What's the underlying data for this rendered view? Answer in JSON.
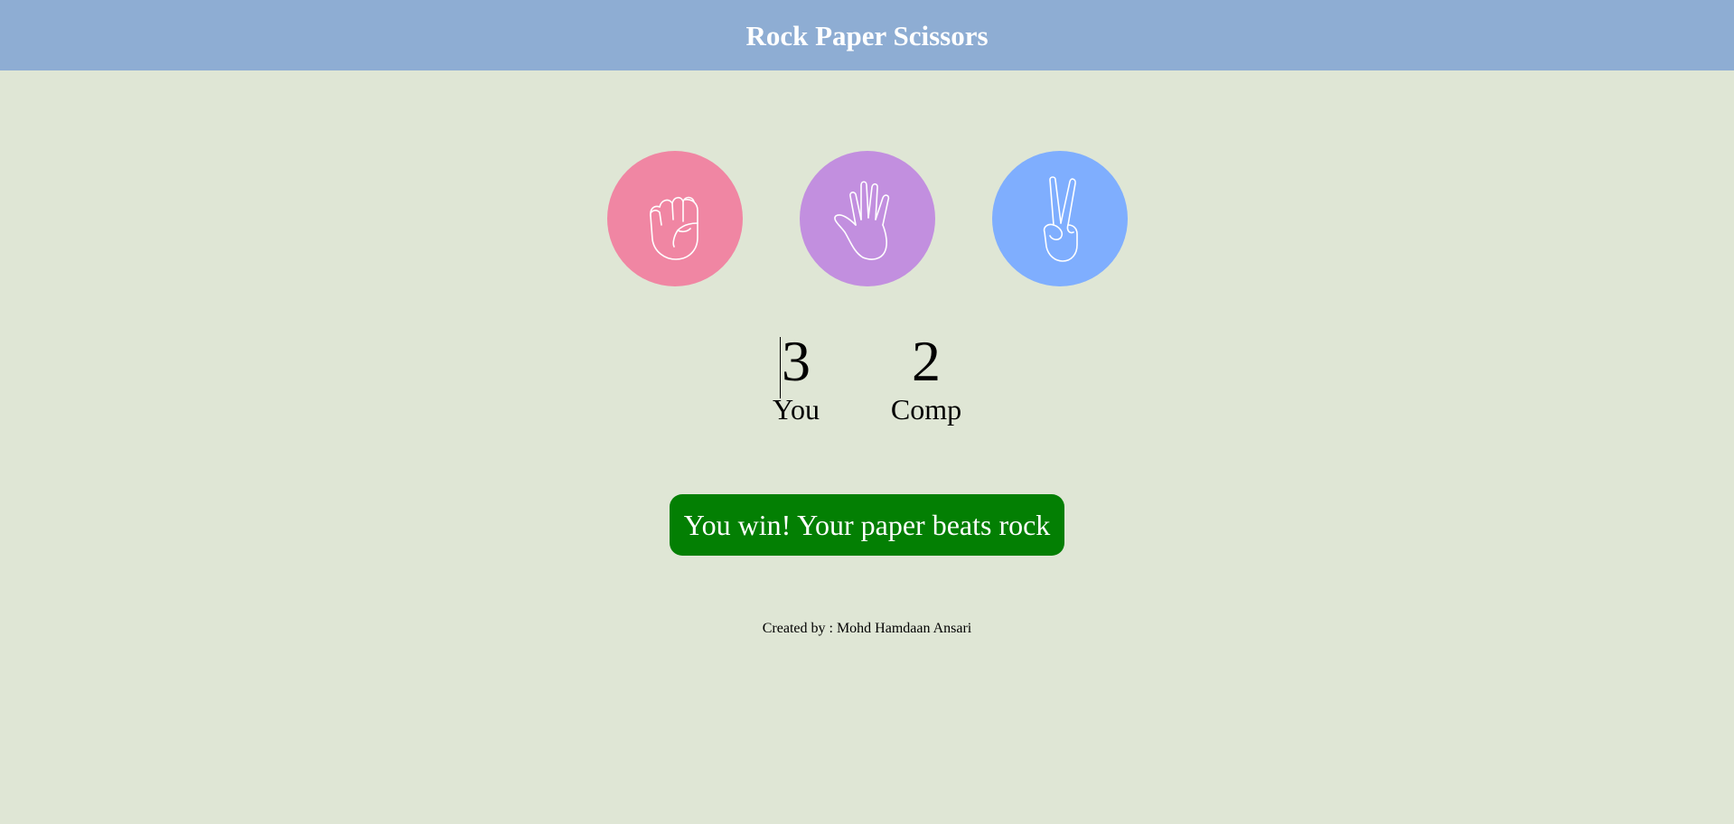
{
  "header": {
    "title": "Rock Paper Scissors",
    "background": "#8eadd3"
  },
  "choices": [
    {
      "id": "rock",
      "icon": "fist-icon",
      "color": "#f086a3"
    },
    {
      "id": "paper",
      "icon": "open-hand-icon",
      "color": "#c28fdf"
    },
    {
      "id": "scissors",
      "icon": "peace-hand-icon",
      "color": "#7faefe"
    }
  ],
  "score": {
    "user_score": "3",
    "user_label": "You",
    "comp_score": "2",
    "comp_label": "Comp"
  },
  "message": {
    "text": "You win! Your paper beats rock",
    "color": "#037f03"
  },
  "footer": {
    "text": "Created by : Mohd Hamdaan Ansari"
  },
  "page_background": "#dfe6d5"
}
